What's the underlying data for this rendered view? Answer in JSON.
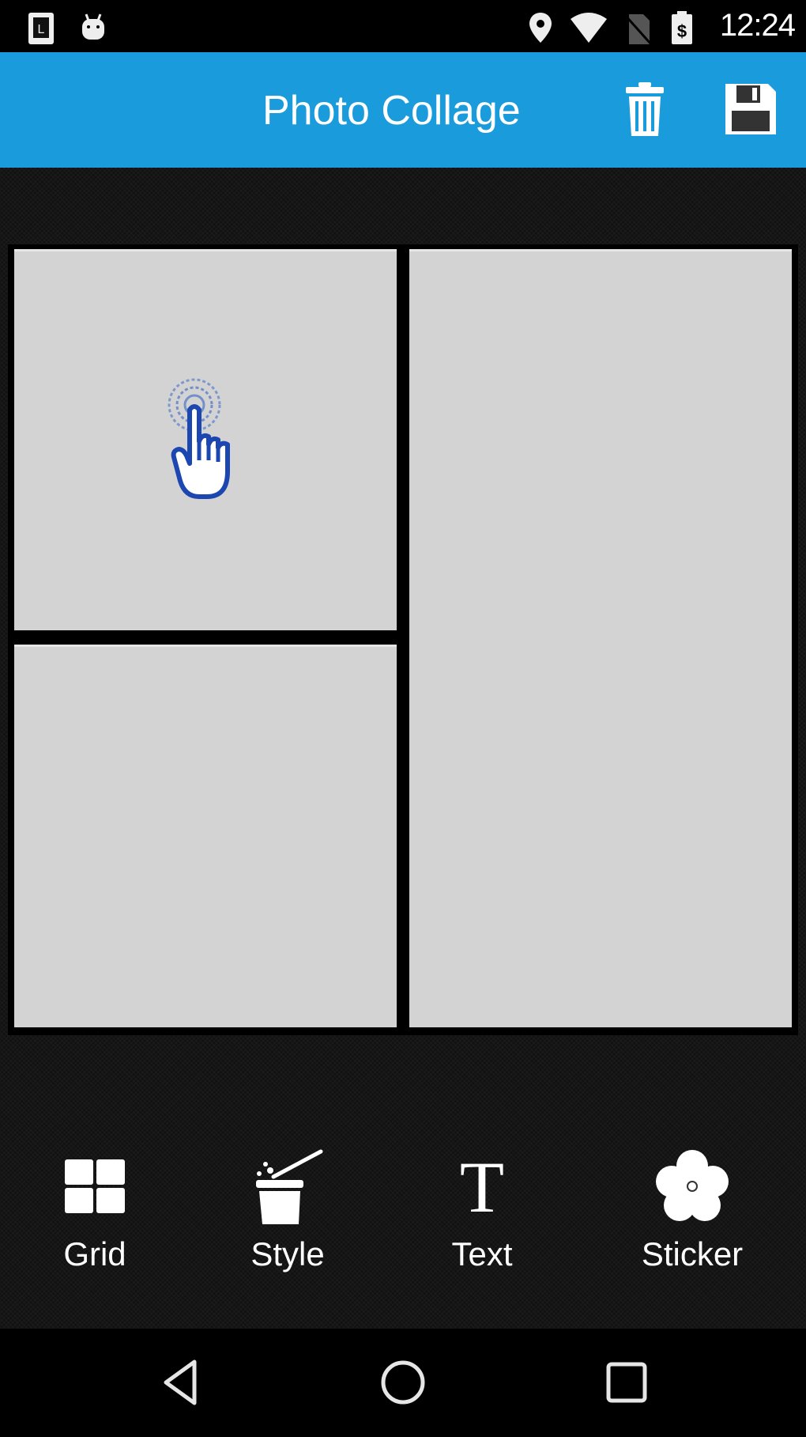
{
  "status_bar": {
    "time": "12:24",
    "icons": [
      "launcher-notification-icon",
      "android-icon",
      "location-icon",
      "wifi-icon",
      "no-sim-icon",
      "battery-icon"
    ]
  },
  "app_bar": {
    "title": "Photo Collage",
    "actions": [
      {
        "name": "delete",
        "icon": "trash-icon"
      },
      {
        "name": "save",
        "icon": "floppy-disk-icon"
      }
    ],
    "color": "#1a9bdc"
  },
  "collage": {
    "layout": "three-cell: two stacked left, one tall right",
    "cells": [
      {
        "id": "top-left",
        "hint_icon": "tap-hand-icon",
        "color": "#d3d3d3"
      },
      {
        "id": "bottom-left",
        "color": "#d3d3d3"
      },
      {
        "id": "right",
        "color": "#d3d3d3"
      }
    ]
  },
  "toolbar": {
    "items": [
      {
        "label": "Grid",
        "icon": "grid-icon"
      },
      {
        "label": "Style",
        "icon": "magic-wand-icon"
      },
      {
        "label": "Text",
        "icon": "text-icon"
      },
      {
        "label": "Sticker",
        "icon": "flower-icon"
      }
    ]
  },
  "nav_bar": {
    "buttons": [
      "back",
      "home",
      "recents"
    ]
  }
}
